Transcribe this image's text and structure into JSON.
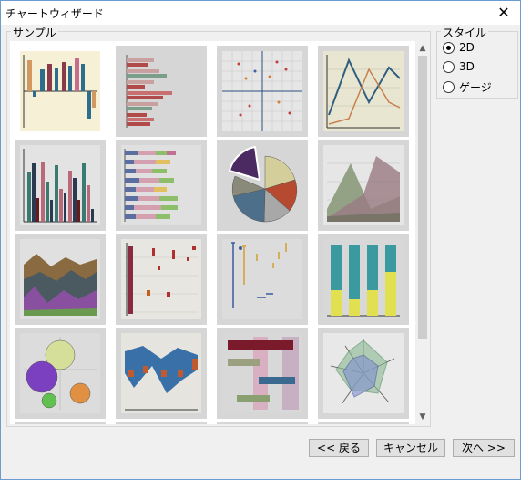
{
  "window": {
    "title": "チャートウィザード",
    "close_glyph": "✕"
  },
  "sample_group": {
    "label": "サンプル"
  },
  "style_group": {
    "label": "スタイル",
    "options": [
      {
        "label": "2D",
        "checked": true
      },
      {
        "label": "3D",
        "checked": false
      },
      {
        "label": "ゲージ",
        "checked": false
      }
    ]
  },
  "tiles": [
    "bar-chart",
    "horizontal-bar-chart",
    "scatter-chart",
    "line-chart",
    "grouped-bar-chart",
    "stacked-horizontal-bar-chart",
    "pie-chart",
    "area-chart",
    "stacked-area-chart",
    "high-low-chart",
    "error-bar-chart",
    "stacked-column-chart",
    "bubble-chart",
    "range-area-chart",
    "gantt-chart",
    "radar-chart"
  ],
  "buttons": {
    "back": "<< 戻る",
    "cancel": "キャンセル",
    "next": "次へ >>"
  },
  "scrollbar": {
    "up": "▲",
    "down": "▼"
  }
}
